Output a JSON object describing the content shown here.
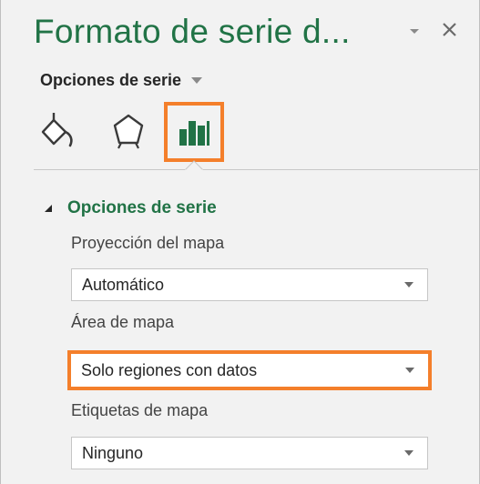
{
  "pane": {
    "title": "Formato de serie d...",
    "series_options_menu": "Opciones de serie",
    "tabs": [
      {
        "name": "fill-line",
        "icon": "paint-bucket-icon"
      },
      {
        "name": "effects",
        "icon": "pentagon-icon"
      },
      {
        "name": "series-options",
        "icon": "bar-chart-icon",
        "selected": true
      }
    ],
    "section": {
      "title": "Opciones de serie",
      "expanded": true
    },
    "fields": {
      "projection": {
        "label": "Proyección del mapa",
        "value": "Automático"
      },
      "map_area": {
        "label": "Área de mapa",
        "value": "Solo regiones con datos"
      },
      "map_labels": {
        "label": "Etiquetas de mapa",
        "value": "Ninguno"
      }
    }
  },
  "colors": {
    "accent_green": "#217346",
    "highlight_orange": "#f47f2b",
    "pane_bg": "#f2f2f2"
  }
}
